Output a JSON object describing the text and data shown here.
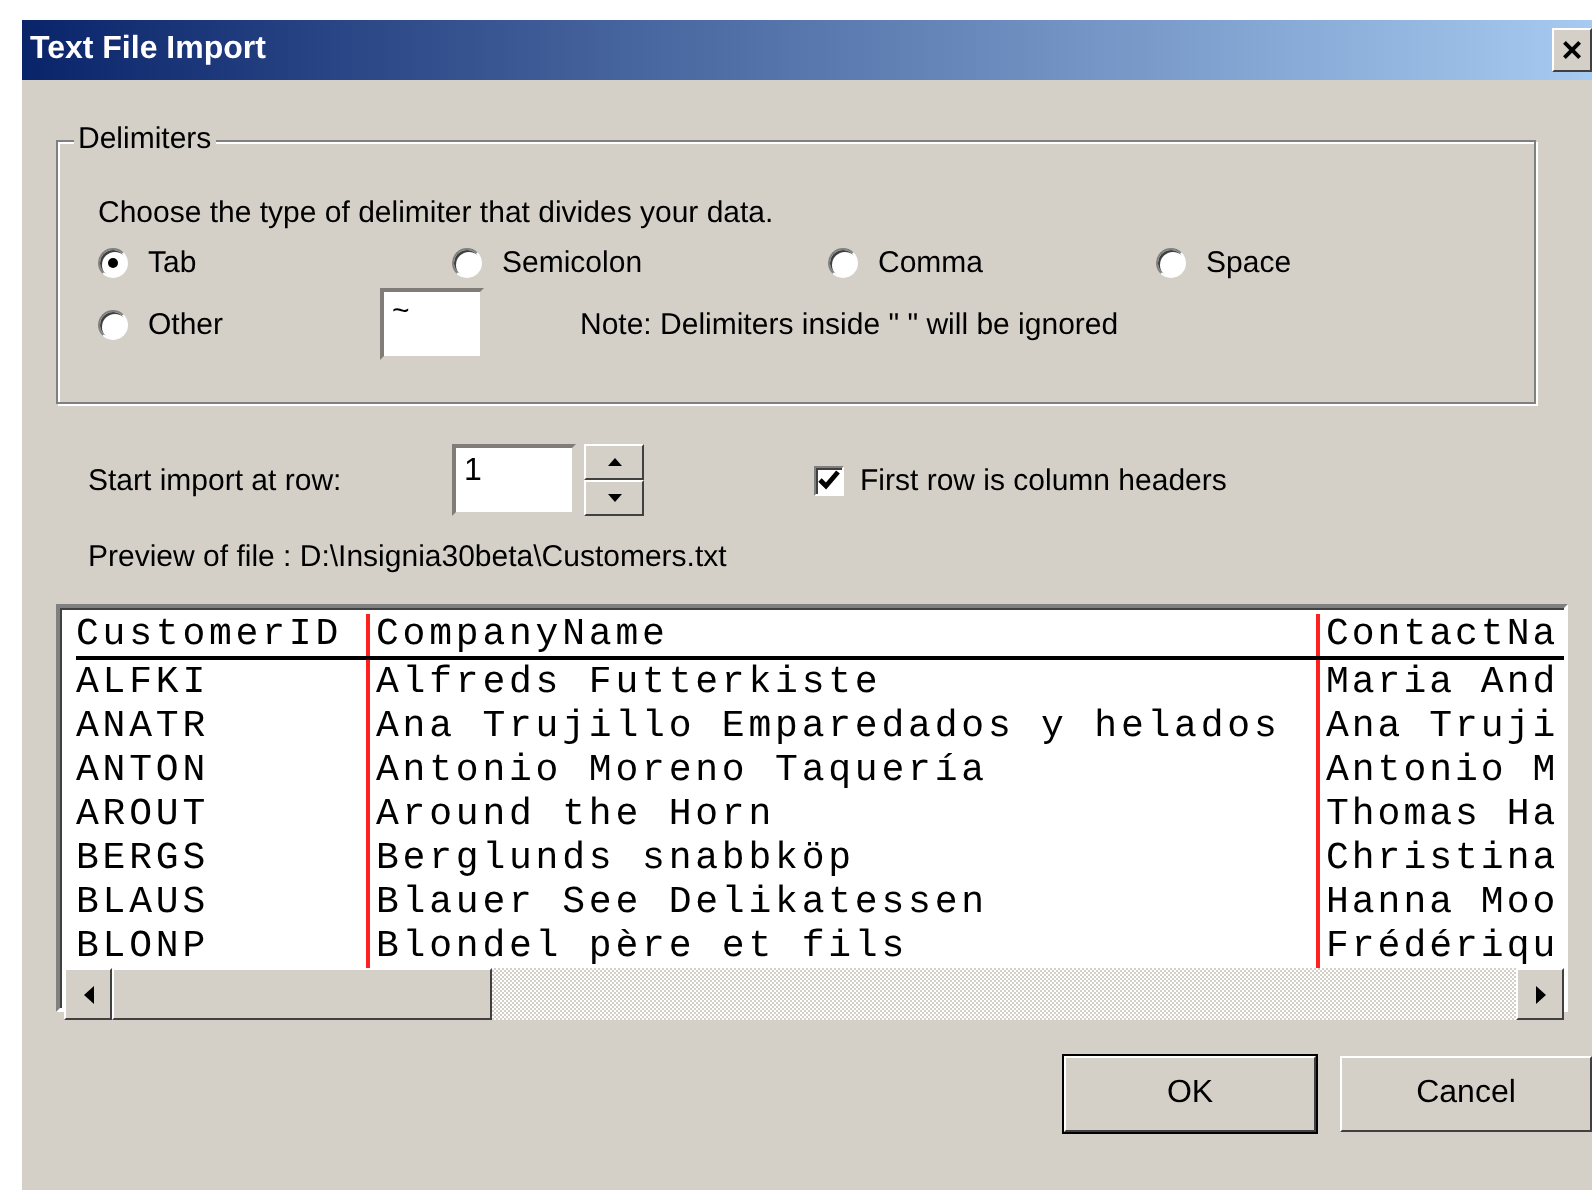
{
  "window": {
    "title": "Text File Import",
    "close": "×"
  },
  "delimiters": {
    "legend": "Delimiters",
    "prompt": "Choose the type of delimiter that divides your data.",
    "options": [
      {
        "label": "Tab",
        "selected": true
      },
      {
        "label": "Semicolon",
        "selected": false
      },
      {
        "label": "Comma",
        "selected": false
      },
      {
        "label": "Space",
        "selected": false
      },
      {
        "label": "Other",
        "selected": false
      }
    ],
    "other_value": "~",
    "note": "Note: Delimiters inside \"  \" will be ignored"
  },
  "start_row": {
    "label": "Start import at row:",
    "value": "1"
  },
  "header_checkbox": {
    "label": "First row is column headers",
    "checked": true
  },
  "preview": {
    "label": "Preview of file : D:\\Insignia30beta\\Customers.txt",
    "columns": [
      "CustomerID",
      "CompanyName",
      "ContactNa"
    ],
    "rows": [
      [
        "ALFKI",
        "Alfreds Futterkiste",
        "Maria And"
      ],
      [
        "ANATR",
        "Ana Trujillo Emparedados y helados",
        "Ana Truji"
      ],
      [
        "ANTON",
        "Antonio Moreno Taquería",
        "Antonio M"
      ],
      [
        "AROUT",
        "Around the Horn",
        "Thomas Ha"
      ],
      [
        "BERGS",
        "Berglunds snabbköp",
        "Christina"
      ],
      [
        "BLAUS",
        "Blauer See Delikatessen",
        "Hanna Moo"
      ],
      [
        "BLONP",
        "Blondel père et fils",
        "Frédériqu"
      ]
    ]
  },
  "buttons": [
    {
      "label": "OK",
      "default": true
    },
    {
      "label": "Cancel",
      "default": false
    }
  ]
}
